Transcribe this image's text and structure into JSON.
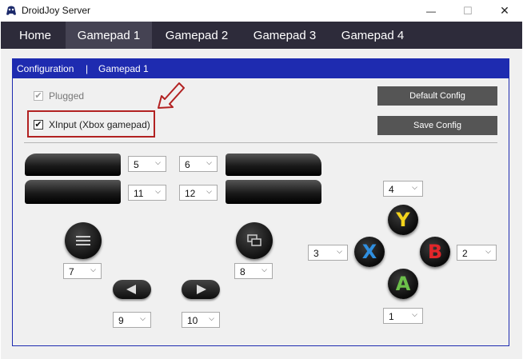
{
  "window": {
    "title": "DroidJoy Server",
    "minimize": "—",
    "maximize": "☐",
    "close": "✕"
  },
  "tabs": [
    "Home",
    "Gamepad 1",
    "Gamepad 2",
    "Gamepad 3",
    "Gamepad 4"
  ],
  "breadcrumb": {
    "section": "Configuration",
    "separator": "|",
    "page": "Gamepad 1"
  },
  "options": {
    "plugged": {
      "label": "Plugged",
      "checked": true
    },
    "xinput": {
      "label": "XInput (Xbox gamepad)",
      "checked": true
    }
  },
  "buttons": {
    "default_config": "Default Config",
    "save_config": "Save Config"
  },
  "mappings": {
    "left_bumper": "5",
    "right_bumper": "6",
    "left_trigger": "11",
    "right_trigger": "12",
    "menu": "7",
    "view": "8",
    "dpad_left": "9",
    "dpad_right": "10",
    "y": "4",
    "x": "3",
    "b": "2",
    "a": "1"
  },
  "face_labels": {
    "y": "Y",
    "x": "X",
    "b": "B",
    "a": "A"
  },
  "colors": {
    "tab_bar": "#2d2b3a",
    "header": "#1e2bb0",
    "annotation": "#b22222",
    "button_y": "#f3d31c",
    "button_x": "#2f8fe0",
    "button_b": "#e2262a",
    "button_a": "#6cc04a"
  },
  "icons": {
    "app": "droidjoy-icon",
    "menu": "hamburger-icon",
    "view": "view-icon",
    "left": "triangle-left-icon",
    "right": "triangle-right-icon",
    "annotation": "arrow-icon"
  }
}
